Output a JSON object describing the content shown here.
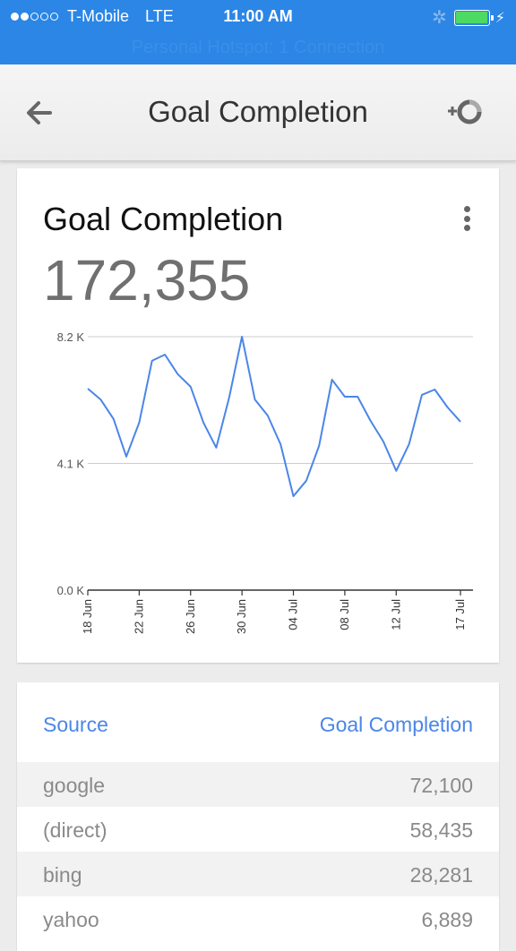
{
  "status_bar": {
    "signal_bars_filled": 2,
    "signal_bars_total": 5,
    "carrier": "T-Mobile",
    "network": "LTE",
    "time": "11:00 AM",
    "bluetooth_icon": "bluetooth-icon",
    "battery_level": 1.0,
    "charging_icon": "bolt-icon",
    "hotspot_text": "Personal Hotspot: 1 Connection"
  },
  "app_bar": {
    "back_icon": "arrow-left-icon",
    "title": "Goal Completion",
    "add_segment_icon": "add-segment-icon"
  },
  "chart_card": {
    "title": "Goal Completion",
    "total": "172,355",
    "menu_icon": "more-vertical-icon"
  },
  "chart_data": {
    "type": "line",
    "title": "Goal Completion",
    "xlabel": "",
    "ylabel": "",
    "ylim": [
      0,
      8200
    ],
    "grid": true,
    "legend": "none",
    "color": "#4a86e8",
    "y_ticks": [
      {
        "value": 0,
        "label": "0.0 K"
      },
      {
        "value": 4100,
        "label": "4.1 K"
      },
      {
        "value": 8200,
        "label": "8.2 K"
      }
    ],
    "x_ticks": [
      {
        "index": 0,
        "label": "18 Jun"
      },
      {
        "index": 4,
        "label": "22 Jun"
      },
      {
        "index": 8,
        "label": "26 Jun"
      },
      {
        "index": 12,
        "label": "30 Jun"
      },
      {
        "index": 16,
        "label": "04 Jul"
      },
      {
        "index": 20,
        "label": "08 Jul"
      },
      {
        "index": 24,
        "label": "12 Jul"
      },
      {
        "index": 29,
        "label": "17 Jul"
      }
    ],
    "x": [
      "18 Jun",
      "19 Jun",
      "20 Jun",
      "21 Jun",
      "22 Jun",
      "23 Jun",
      "24 Jun",
      "25 Jun",
      "26 Jun",
      "27 Jun",
      "28 Jun",
      "29 Jun",
      "30 Jun",
      "01 Jul",
      "02 Jul",
      "03 Jul",
      "04 Jul",
      "05 Jul",
      "06 Jul",
      "07 Jul",
      "08 Jul",
      "09 Jul",
      "10 Jul",
      "11 Jul",
      "12 Jul",
      "13 Jul",
      "14 Jul",
      "15 Jul",
      "16 Jul",
      "17 Jul"
    ],
    "series": [
      {
        "name": "Goal Completion",
        "values": [
          6520,
          6170,
          5540,
          4320,
          5420,
          7420,
          7620,
          6990,
          6580,
          5420,
          4610,
          6230,
          8200,
          6170,
          5650,
          4720,
          3040,
          3540,
          4670,
          6810,
          6260,
          6260,
          5480,
          4810,
          3860,
          4720,
          6320,
          6490,
          5910,
          5450
        ]
      }
    ]
  },
  "table": {
    "headers": [
      "Source",
      "Goal Completion"
    ],
    "rows": [
      {
        "source": "google",
        "value": "72,100"
      },
      {
        "source": "(direct)",
        "value": "58,435"
      },
      {
        "source": "bing",
        "value": "28,281"
      },
      {
        "source": "yahoo",
        "value": "6,889"
      }
    ]
  }
}
